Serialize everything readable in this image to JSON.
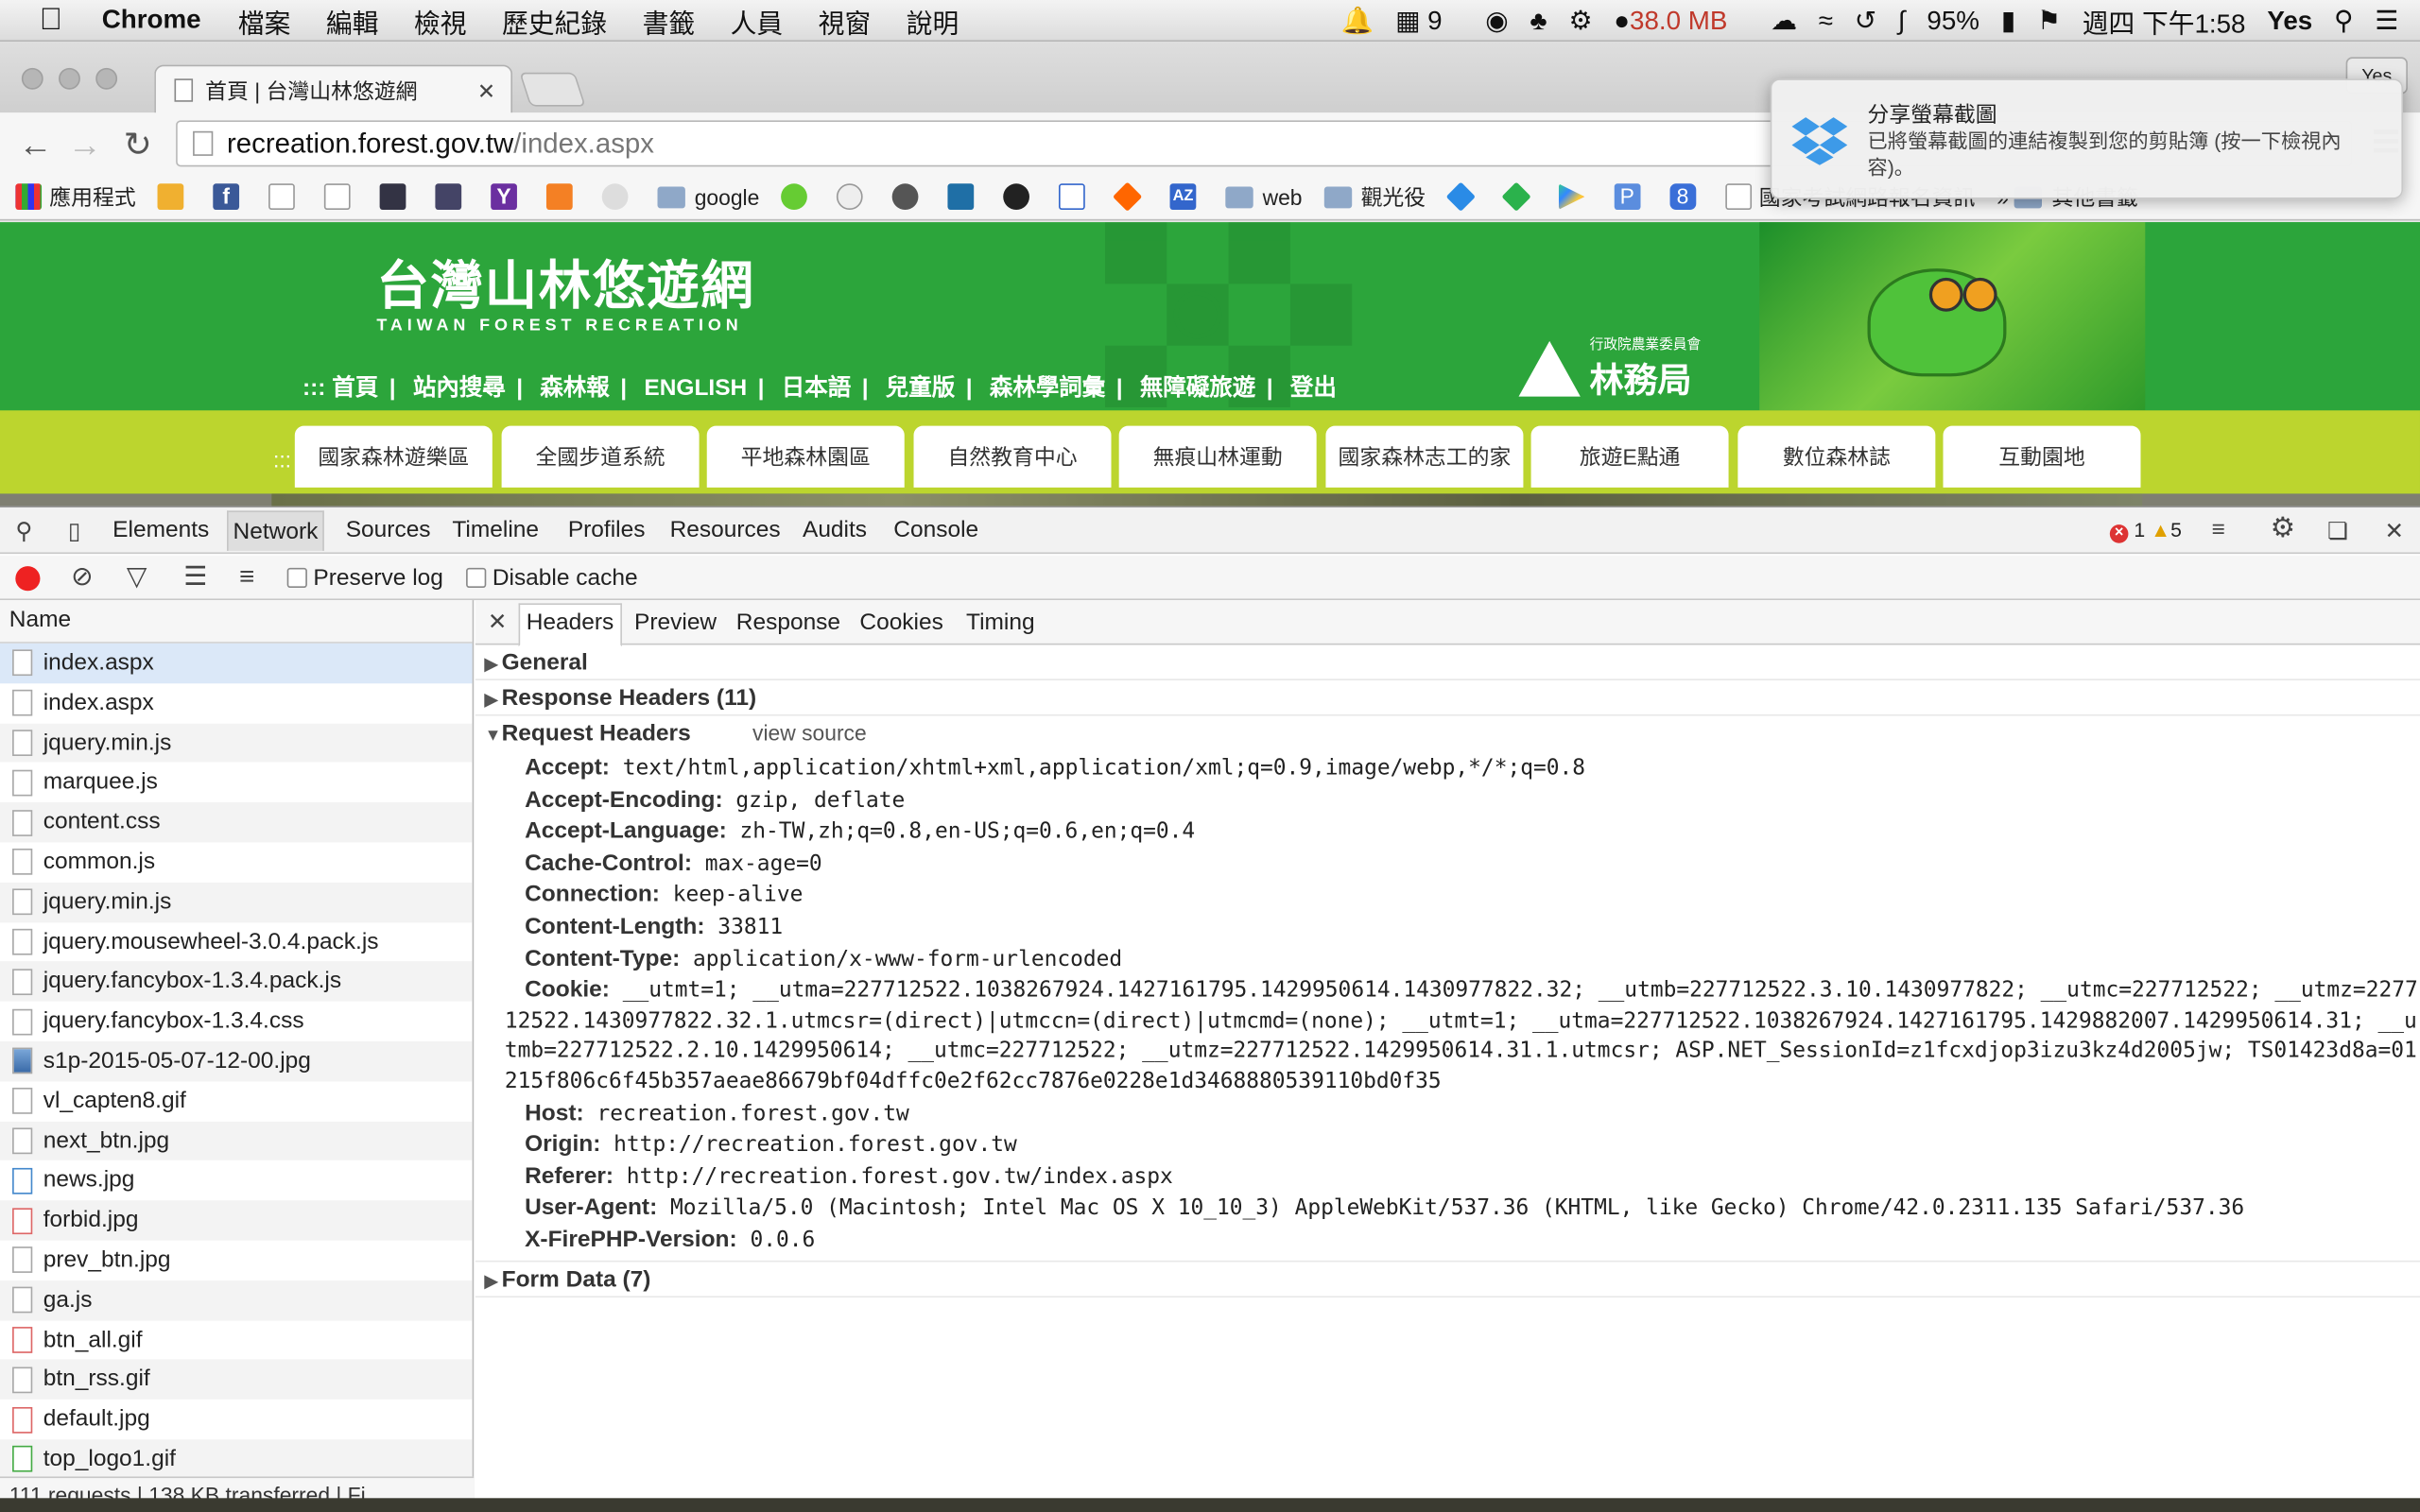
{
  "menubar": {
    "app": "Chrome",
    "items": [
      "檔案",
      "編輯",
      "檢視",
      "歷史紀錄",
      "書籤",
      "人員",
      "視窗",
      "說明"
    ],
    "ai_count": "9",
    "memory": "38.0 MB",
    "battery": "95%",
    "datetime": "週四 下午1:58",
    "user": "Yes"
  },
  "browser": {
    "tab_title": "首頁 | 台灣山林悠遊網",
    "user_button": "Yes",
    "url_host": "recreation.forest.gov.tw",
    "url_path": "/index.aspx"
  },
  "bookmarks": {
    "apps": "應用程式",
    "google": "google",
    "web": "web",
    "tourism": "觀光役",
    "exam": "國家考試網路報名資訊",
    "other": "其他書籤"
  },
  "notification": {
    "title": "分享螢幕截圖",
    "body": "已將螢幕截圖的連結複製到您的剪貼簿 (按一下檢視內容)。"
  },
  "site": {
    "logo_cn": "台灣山林悠遊網",
    "logo_en": "TAIWAN FOREST RECREATION",
    "topnav_prefix": ":::",
    "topnav": [
      "首頁",
      "站內搜尋",
      "森林報",
      "ENGLISH",
      "日本語",
      "兒童版",
      "森林學詞彙",
      "無障礙旅遊",
      "登出"
    ],
    "agency_small": "行政院農業委員會",
    "agency": "林務局",
    "categories_prefix": ":::",
    "categories": [
      "國家森林遊樂區",
      "全國步道系統",
      "平地森林園區",
      "自然教育中心",
      "無痕山林運動",
      "國家森林志工的家",
      "旅遊E點通",
      "數位森林誌",
      "互動園地"
    ]
  },
  "devtools": {
    "tabs": [
      "Elements",
      "Network",
      "Sources",
      "Timeline",
      "Profiles",
      "Resources",
      "Audits",
      "Console"
    ],
    "active_tab": "Network",
    "errors": "1",
    "warnings": "5",
    "preserve_log": "Preserve log",
    "disable_cache": "Disable cache",
    "name_header": "Name",
    "files": [
      "index.aspx",
      "index.aspx",
      "jquery.min.js",
      "marquee.js",
      "content.css",
      "common.js",
      "jquery.min.js",
      "jquery.mousewheel-3.0.4.pack.js",
      "jquery.fancybox-1.3.4.pack.js",
      "jquery.fancybox-1.3.4.css",
      "s1p-2015-05-07-12-00.jpg",
      "vl_capten8.gif",
      "next_btn.jpg",
      "news.jpg",
      "forbid.jpg",
      "prev_btn.jpg",
      "ga.js",
      "btn_all.gif",
      "btn_rss.gif",
      "default.jpg",
      "top_logo1.gif"
    ],
    "status": "111 requests | 138 KB transferred | Fi...",
    "detail_tabs": [
      "Headers",
      "Preview",
      "Response",
      "Cookies",
      "Timing"
    ],
    "sections": {
      "general": "General",
      "response_headers": "Response Headers (11)",
      "request_headers": "Request Headers",
      "view_source": "view source",
      "form_data": "Form Data (7)"
    },
    "request_headers": [
      {
        "k": "Accept:",
        "v": "text/html,application/xhtml+xml,application/xml;q=0.9,image/webp,*/*;q=0.8"
      },
      {
        "k": "Accept-Encoding:",
        "v": "gzip, deflate"
      },
      {
        "k": "Accept-Language:",
        "v": "zh-TW,zh;q=0.8,en-US;q=0.6,en;q=0.4"
      },
      {
        "k": "Cache-Control:",
        "v": "max-age=0"
      },
      {
        "k": "Connection:",
        "v": "keep-alive"
      },
      {
        "k": "Content-Length:",
        "v": "33811"
      },
      {
        "k": "Content-Type:",
        "v": "application/x-www-form-urlencoded"
      },
      {
        "k": "Cookie:",
        "v": "__utmt=1; __utma=227712522.1038267924.1427161795.1429950614.1430977822.32; __utmb=227712522.3.10.1430977822; __utmc=227712522; __utmz=227712522.1430977822.32.1.utmcsr=(direct)|utmccn=(direct)|utmcmd=(none); __utmt=1; __utma=227712522.1038267924.1427161795.1429882007.1429950614.31; __utmb=227712522.2.10.1429950614; __utmc=227712522; __utmz=227712522.1429950614.31.1.utmcsr; ASP.NET_SessionId=z1fcxdjop3izu3kz4d2005jw; TS01423d8a=01215f806c6f45b357aeae86679bf04dffc0e2f62cc7876e0228e1d3468880539110bd0f35"
      },
      {
        "k": "Host:",
        "v": "recreation.forest.gov.tw"
      },
      {
        "k": "Origin:",
        "v": "http://recreation.forest.gov.tw"
      },
      {
        "k": "Referer:",
        "v": "http://recreation.forest.gov.tw/index.aspx"
      },
      {
        "k": "User-Agent:",
        "v": "Mozilla/5.0 (Macintosh; Intel Mac OS X 10_10_3) AppleWebKit/537.36 (KHTML, like Gecko) Chrome/42.0.2311.135 Safari/537.36"
      },
      {
        "k": "X-FirePHP-Version:",
        "v": "0.0.6"
      }
    ]
  }
}
